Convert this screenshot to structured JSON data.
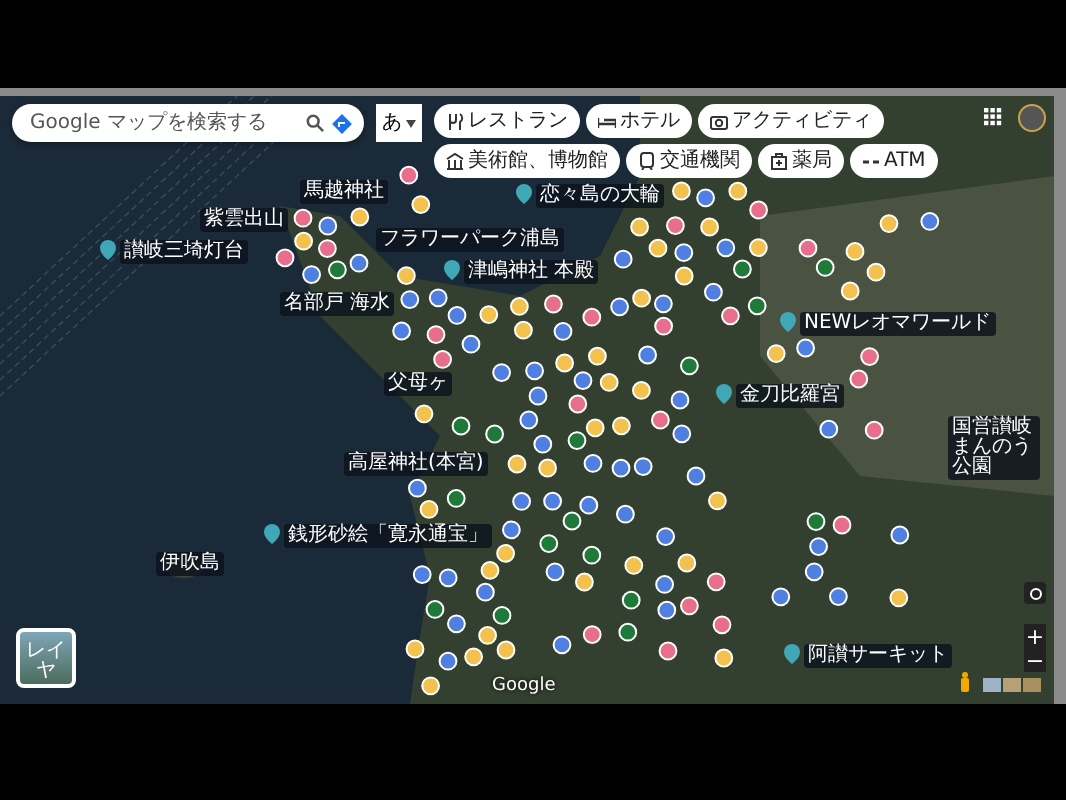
{
  "search": {
    "placeholder": "Google マップを検索する"
  },
  "input_mode": {
    "label": "あ"
  },
  "chips": [
    {
      "label": "レストラン",
      "kind": "restaurant"
    },
    {
      "label": "ホテル",
      "kind": "hotel"
    },
    {
      "label": "アクティビティ",
      "kind": "activity"
    },
    {
      "label": "美術館、博物館",
      "kind": "museum"
    },
    {
      "label": "交通機関",
      "kind": "transit"
    },
    {
      "label": "薬局",
      "kind": "pharmacy"
    },
    {
      "label": "ATM",
      "kind": "atm"
    }
  ],
  "map_labels": [
    {
      "text": "馬越神社",
      "kind": "place"
    },
    {
      "text": "恋々島の大輪",
      "kind": "poi"
    },
    {
      "text": "讃岐三埼灯台",
      "kind": "poi"
    },
    {
      "text": "紫雲出山",
      "kind": "place"
    },
    {
      "text": "フラワーパーク浦島",
      "kind": "place"
    },
    {
      "text": "津嶋神社 本殿",
      "kind": "poi"
    },
    {
      "text": "名部戸 海水",
      "kind": "place"
    },
    {
      "text": "父母ヶ",
      "kind": "place"
    },
    {
      "text": "高屋神社(本宮)",
      "kind": "place"
    },
    {
      "text": "銭形砂絵「寛永通宝」",
      "kind": "poi"
    },
    {
      "text": "伊吹島",
      "kind": "place"
    },
    {
      "text": "金刀比羅宮",
      "kind": "poi"
    },
    {
      "text": "NEWレオマワールド",
      "kind": "poi"
    },
    {
      "text": "阿讃サーキット",
      "kind": "poi"
    },
    {
      "text": "国営讃岐まんのう公園",
      "kind": "place"
    }
  ],
  "layers_button": {
    "label": "レイヤ"
  },
  "logo": "Google",
  "zoom_controls": {
    "zoom_in": "+",
    "zoom_out": "−"
  }
}
